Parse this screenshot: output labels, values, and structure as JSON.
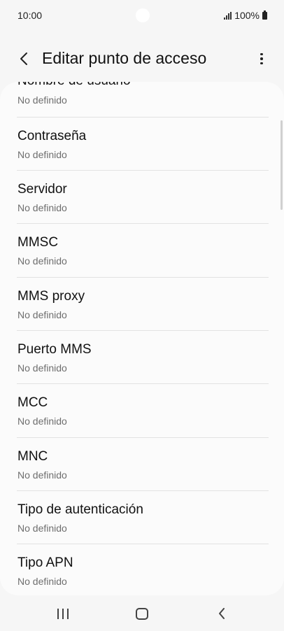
{
  "status_bar": {
    "time": "10:00",
    "battery": "100%",
    "icons": [
      "signal-icon",
      "battery-icon"
    ]
  },
  "header": {
    "title": "Editar punto de acceso",
    "back_icon": "chevron-left-icon",
    "more_icon": "more-vertical-icon"
  },
  "settings": [
    {
      "label": "Nombre de usuario",
      "value": "No definido"
    },
    {
      "label": "Contraseña",
      "value": "No definido"
    },
    {
      "label": "Servidor",
      "value": "No definido"
    },
    {
      "label": "MMSC",
      "value": "No definido"
    },
    {
      "label": "MMS proxy",
      "value": "No definido"
    },
    {
      "label": "Puerto MMS",
      "value": "No definido"
    },
    {
      "label": "MCC",
      "value": "No definido"
    },
    {
      "label": "MNC",
      "value": "No definido"
    },
    {
      "label": "Tipo de autenticación",
      "value": "No definido"
    },
    {
      "label": "Tipo APN",
      "value": "No definido"
    }
  ],
  "nav_bar": {
    "icons": [
      "recents-icon",
      "home-icon",
      "back-icon"
    ]
  }
}
